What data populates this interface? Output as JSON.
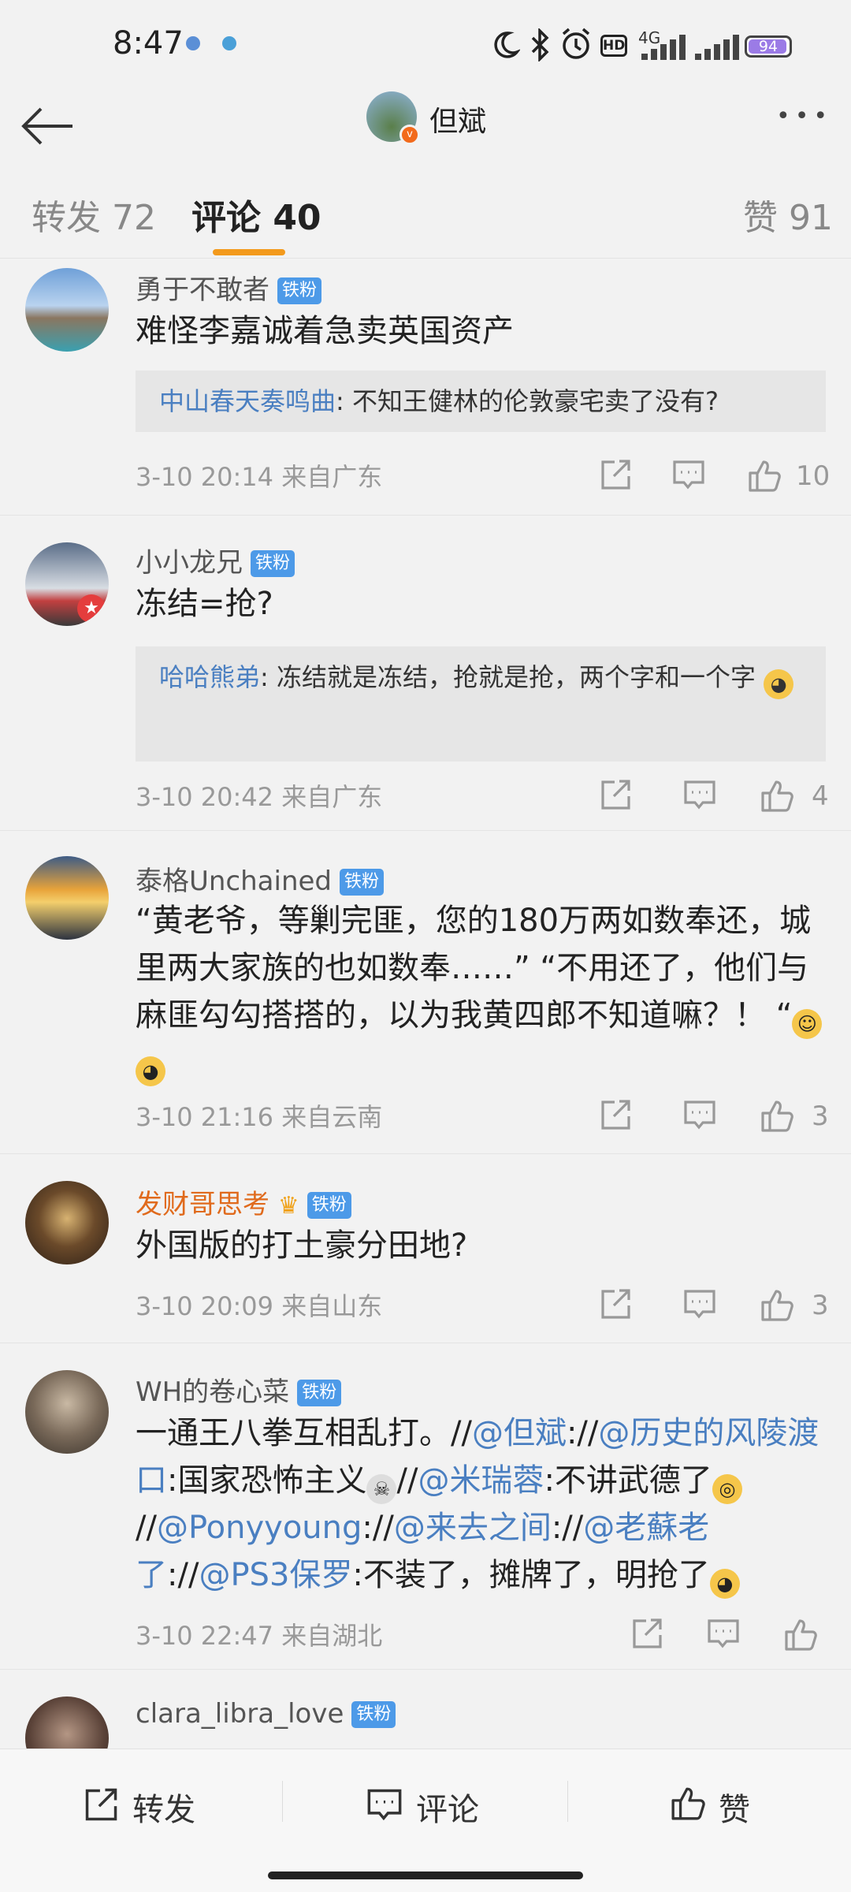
{
  "status": {
    "time": "8:47",
    "hd": "HD",
    "network": "4G",
    "battery": "94"
  },
  "header": {
    "title": "但斌"
  },
  "tabs": [
    {
      "label": "转发 72"
    },
    {
      "label": "评论 40"
    },
    {
      "label": "赞 91"
    }
  ],
  "fan_badge": "铁粉",
  "comments": [
    {
      "user": "勇于不敢者",
      "text": "难怪李嘉诚着急卖英国资产",
      "quote_user": "中山春天奏鸣曲",
      "quote_text": ": 不知王健林的伦敦豪宅卖了没有?",
      "time": "3-10 20:14",
      "location": "来自广东",
      "likes": "10"
    },
    {
      "user": "小小龙兄",
      "text": "冻结=抢?",
      "quote_user": "哈哈熊弟",
      "quote_text": ": 冻结就是冻结，抢就是抢，两个字和一个字",
      "time": "3-10 20:42",
      "location": "来自广东",
      "likes": "4"
    },
    {
      "user": "泰格Unchained",
      "text": "“黄老爷，等剿完匪，您的180万两如数奉还，城里两大家族的也如数奉……” “不用还了，他们与麻匪勾勾搭搭的，以为我黄四郎不知道嘛？！ “",
      "time": "3-10 21:16",
      "location": "来自云南",
      "likes": "3"
    },
    {
      "user": "发财哥思考",
      "text": "外国版的打土豪分田地?",
      "time": "3-10 20:09",
      "location": "来自山东",
      "likes": "3"
    },
    {
      "user": "WH的卷心菜",
      "text_parts": {
        "p1": "一通王八拳互相乱打。//",
        "l1": "@但斌",
        "p2": "://",
        "l2": "@历史的风陵渡口",
        "p3": ":国家恐怖主义",
        "p4": "//",
        "l3": "@米瑞蓉",
        "p5": ":不讲武德了",
        "p6": "//",
        "l4": "@Ponyyoung",
        "p7": "://",
        "l5": "@来去之间",
        "p8": "://",
        "l6": "@老蘇老了",
        "p9": "://",
        "l7": "@PS3保罗",
        "p10": ":不装了，摊牌了，明抢了"
      },
      "time": "3-10 22:47",
      "location": "来自湖北"
    },
    {
      "user": "clara_libra_love"
    }
  ],
  "bottom": {
    "forward": "转发",
    "comment": "评论",
    "like": "赞"
  },
  "colors": {
    "accent": "#f39a1c",
    "link": "#4a7fc1",
    "fan_badge": "#4d9ae8"
  }
}
